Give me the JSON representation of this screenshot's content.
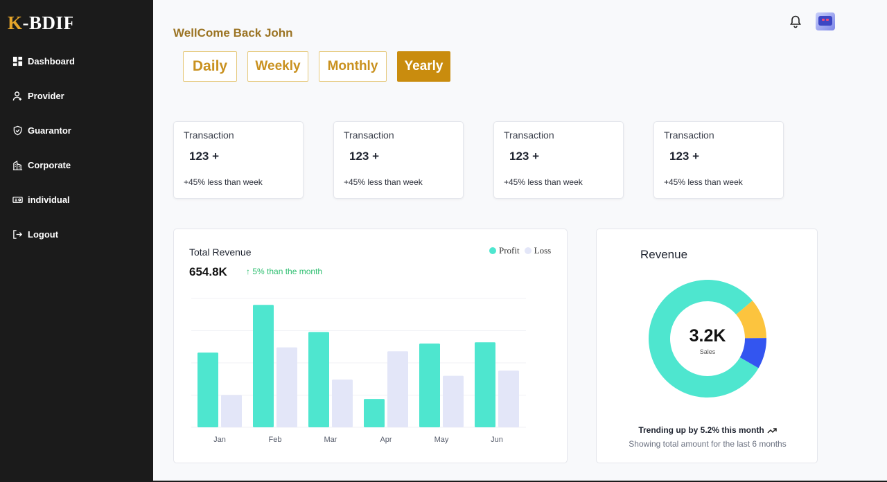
{
  "brand": {
    "k": "K",
    "rest": "-BDIF"
  },
  "sidebar": {
    "items": [
      {
        "label": "Dashboard",
        "icon": "dashboard-icon"
      },
      {
        "label": "Provider",
        "icon": "user-icon"
      },
      {
        "label": "Guarantor",
        "icon": "shield-icon"
      },
      {
        "label": "Corporate",
        "icon": "building-icon"
      },
      {
        "label": "individual",
        "icon": "id-card-icon"
      },
      {
        "label": "Logout",
        "icon": "logout-icon"
      }
    ]
  },
  "header": {
    "welcome": "WellCome Back John",
    "bell_icon": "bell-icon",
    "avatar": "avatar"
  },
  "periods": [
    {
      "label": "Daily",
      "active": false
    },
    {
      "label": "Weekly",
      "active": false
    },
    {
      "label": "Monthly",
      "active": false
    },
    {
      "label": "Yearly",
      "active": true
    }
  ],
  "stats": [
    {
      "label": "Transaction",
      "value": "123 +",
      "change": "+45% less than week"
    },
    {
      "label": "Transaction",
      "value": "123 +",
      "change": "+45% less than week"
    },
    {
      "label": "Transaction",
      "value": "123 +",
      "change": "+45% less than week"
    },
    {
      "label": "Transaction",
      "value": "123 +",
      "change": "+45% less than week"
    }
  ],
  "revenue": {
    "title": "Total Revenue",
    "amount": "654.8K",
    "trend_arrow": "↑",
    "trend": "5% than the month",
    "legend": {
      "profit": "Profit",
      "loss": "Loss"
    }
  },
  "chart_data": {
    "type": "bar",
    "categories": [
      "Jan",
      "Feb",
      "Mar",
      "Apr",
      "May",
      "Jun"
    ],
    "series": [
      {
        "name": "Profit",
        "values": [
          58,
          95,
          74,
          22,
          65,
          66
        ]
      },
      {
        "name": "Loss",
        "values": [
          25,
          62,
          37,
          59,
          40,
          44
        ]
      }
    ],
    "ylim": [
      0,
      100
    ],
    "grid": true,
    "legend_position": "top-right",
    "colors": {
      "Profit": "#4ee6cf",
      "Loss": "#e3e6f8"
    }
  },
  "donut": {
    "title": "Revenue",
    "value": "3.2K",
    "label": "Sales",
    "trend": "Trending up by 5.2% this month",
    "subtitle": "Showing total amount for the last 6 months",
    "segments": [
      {
        "value": 80.5,
        "color": "#4ee6cf"
      },
      {
        "value": 11,
        "color": "#fcc43e"
      },
      {
        "value": 8.5,
        "color": "#3355f0"
      }
    ]
  }
}
